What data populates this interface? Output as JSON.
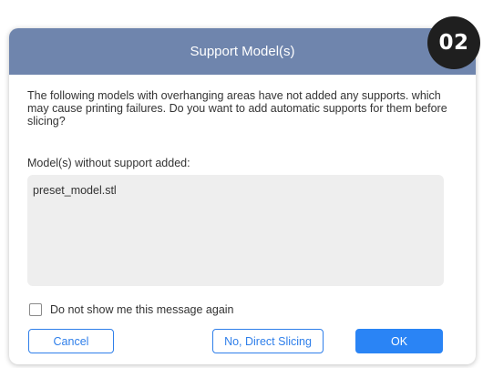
{
  "dialog": {
    "title": "Support Model(s)",
    "message": "The following models with overhanging areas have not added any supports. which may cause printing failures. Do you want to add automatic supports for them before slicing?",
    "section_label": "Model(s) without support added:",
    "models": [
      "preset_model.stl"
    ],
    "checkbox": {
      "label": "Do not show me this message again",
      "checked": false
    },
    "buttons": {
      "cancel": "Cancel",
      "direct_slicing": "No, Direct Slicing",
      "ok": "OK"
    }
  },
  "badge": {
    "text": "02"
  },
  "colors": {
    "titlebar": "#6f85ad",
    "accent": "#2a84f5",
    "list_background": "#eeeeee",
    "badge_background": "#1f1f1f"
  }
}
